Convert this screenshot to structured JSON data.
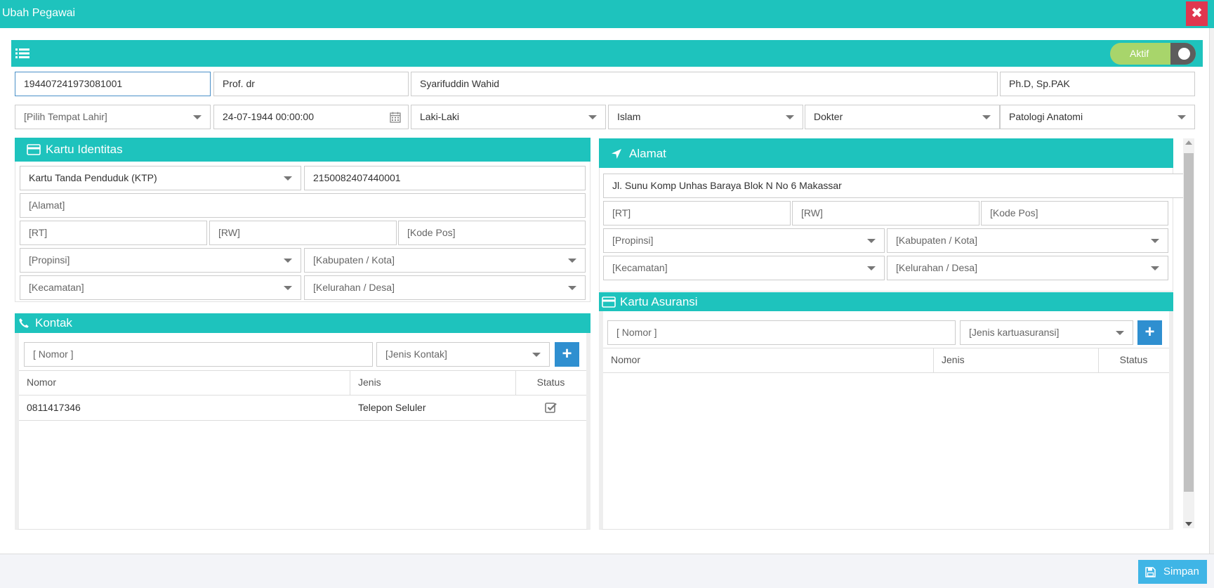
{
  "window": {
    "title": "Ubah Pegawai",
    "close_symbol": "✖"
  },
  "status_toggle": {
    "label": "Aktif",
    "on": true
  },
  "row1": {
    "nip": "194407241973081001",
    "gelar_depan": "Prof. dr",
    "nama": "Syarifuddin Wahid",
    "gelar_belakang": "Ph.D, Sp.PAK"
  },
  "row2": {
    "tempat_lahir_placeholder": "[Pilih Tempat Lahir]",
    "tanggal_lahir": "24-07-1944 00:00:00",
    "jenis_kelamin": "Laki-Laki",
    "agama": "Islam",
    "profesi": "Dokter",
    "unit": "Patologi Anatomi"
  },
  "kartu_identitas": {
    "heading": "Kartu Identitas",
    "jenis_kartu": "Kartu Tanda Penduduk (KTP)",
    "nomor": "2150082407440001",
    "alamat_placeholder": "[Alamat]",
    "rt_placeholder": "[RT]",
    "rw_placeholder": "[RW]",
    "kode_pos_placeholder": "[Kode Pos]",
    "propinsi_placeholder": "[Propinsi]",
    "kabupaten_placeholder": "[Kabupaten / Kota]",
    "kecamatan_placeholder": "[Kecamatan]",
    "kelurahan_placeholder": "[Kelurahan / Desa]"
  },
  "alamat": {
    "heading": "Alamat",
    "jalan": "Jl. Sunu Komp Unhas Baraya Blok N No 6 Makassar",
    "rt_placeholder": "[RT]",
    "rw_placeholder": "[RW]",
    "kode_pos_placeholder": "[Kode Pos]",
    "propinsi_placeholder": "[Propinsi]",
    "kabupaten_placeholder": "[Kabupaten / Kota]",
    "kecamatan_placeholder": "[Kecamatan]",
    "kelurahan_placeholder": "[Kelurahan / Desa]"
  },
  "kontak": {
    "heading": "Kontak",
    "nomor_placeholder": "[ Nomor ]",
    "jenis_placeholder": "[Jenis Kontak]",
    "add_symbol": "+",
    "columns": [
      "Nomor",
      "Jenis",
      "Status"
    ],
    "rows": [
      {
        "nomor": "0811417346",
        "jenis": "Telepon Seluler",
        "status_checked": true
      }
    ]
  },
  "kartu_asuransi": {
    "heading": "Kartu Asuransi",
    "nomor_placeholder": "[ Nomor ]",
    "jenis_placeholder": "[Jenis kartuasuransi]",
    "add_symbol": "+",
    "columns": [
      "Nomor",
      "Jenis",
      "Status"
    ]
  },
  "footer": {
    "save_label": "Simpan"
  },
  "colors": {
    "teal": "#1ec3bd",
    "close_red": "#e0374f",
    "add_blue": "#2f8fd0",
    "save_blue": "#3fb5e6",
    "toggle_green": "#a8d56b"
  },
  "icons": [
    "list-icon",
    "credit-card-icon",
    "location-arrow-icon",
    "phone-icon",
    "calendar-icon",
    "save-icon",
    "check-square-icon",
    "close-icon"
  ]
}
